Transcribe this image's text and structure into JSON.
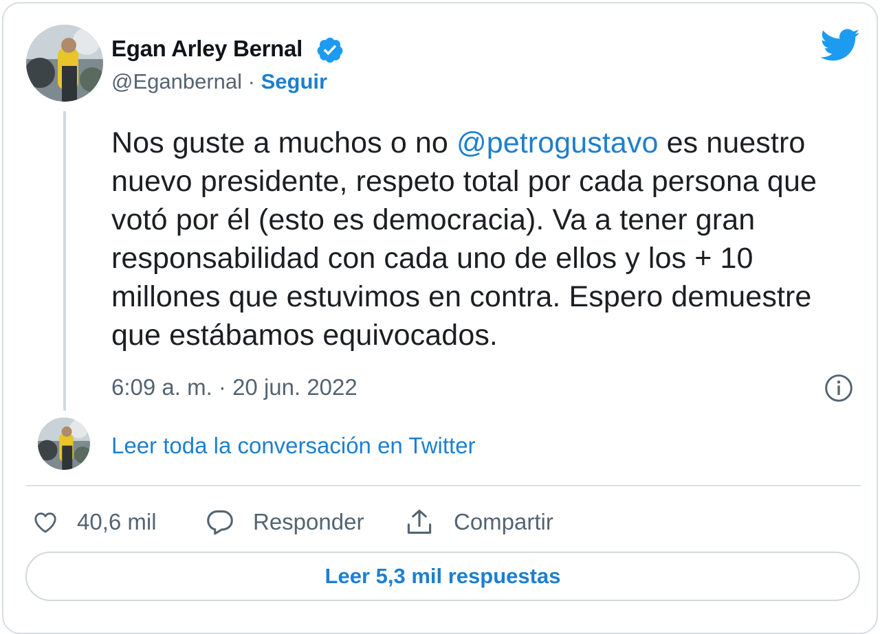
{
  "author": {
    "name": "Egan Arley Bernal",
    "handle": "@Eganbernal",
    "separator": " · ",
    "follow_label": "Seguir"
  },
  "tweet": {
    "text_before": "Nos guste a muchos o no ",
    "mention": "@petrogustavo",
    "text_after": " es nuestro nuevo presidente, respeto total por cada persona que votó por él (esto es democracia). Va a tener gran responsabilidad con cada uno de ellos y los + 10 millones que estuvimos en contra. Espero demuestre que estábamos equivocados.",
    "timestamp": "6:09 a. m. · 20 jun. 2022"
  },
  "conversation": {
    "link_label": "Leer toda la conversación en Twitter"
  },
  "actions": {
    "like_count": "40,6 mil",
    "reply_label": "Responder",
    "share_label": "Compartir"
  },
  "replies_button": "Leer 5,3 mil respuestas",
  "colors": {
    "accent": "#1d7fcf",
    "twitter_blue": "#1d9bf0",
    "muted": "#536471",
    "border": "#cfd9de"
  },
  "icons": [
    "verified-badge-icon",
    "twitter-bird-icon",
    "info-icon",
    "heart-icon",
    "reply-bubble-icon",
    "share-icon"
  ]
}
